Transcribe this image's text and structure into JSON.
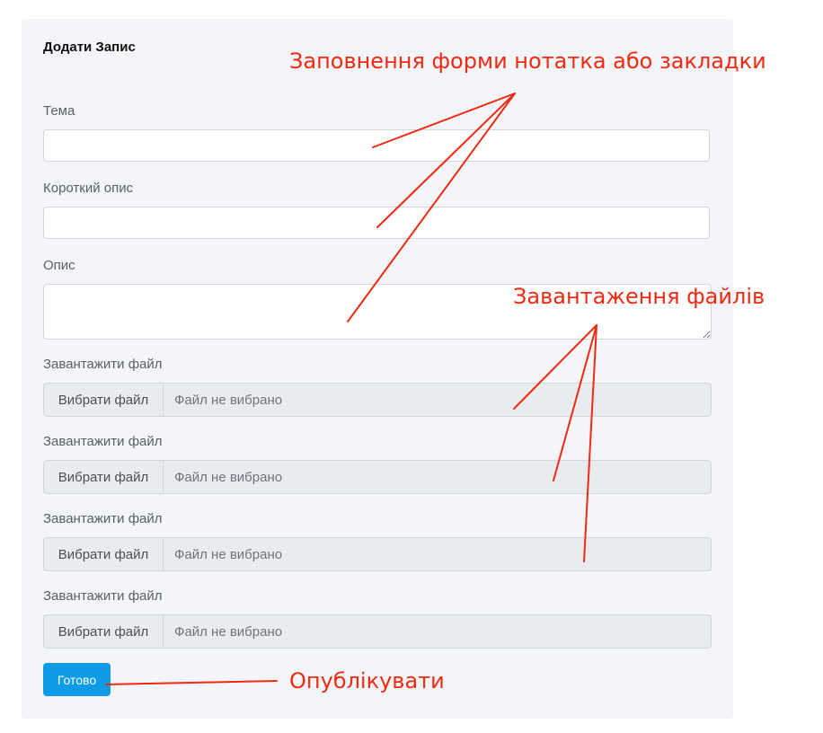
{
  "form": {
    "title": "Додати Запис",
    "topic_label": "Тема",
    "topic_value": "",
    "short_desc_label": "Короткий опис",
    "short_desc_value": "",
    "desc_label": "Опис",
    "desc_value": "",
    "uploads": [
      {
        "label": "Завантажити файл",
        "button": "Вибрати файл",
        "status": "Файл не вибрано"
      },
      {
        "label": "Завантажити файл",
        "button": "Вибрати файл",
        "status": "Файл не вибрано"
      },
      {
        "label": "Завантажити файл",
        "button": "Вибрати файл",
        "status": "Файл не вибрано"
      },
      {
        "label": "Завантажити файл",
        "button": "Вибрати файл",
        "status": "Файл не вибрано"
      }
    ],
    "submit_label": "Готово"
  },
  "annotations": {
    "fill_form": "Заповнення форми нотатка або закладки",
    "upload_files": "Завантаження файлів",
    "publish": "Опублікувати"
  },
  "colors": {
    "annotation": "#f02a12",
    "primary_button": "#0d9be8",
    "card_background": "#f3f5f8"
  }
}
